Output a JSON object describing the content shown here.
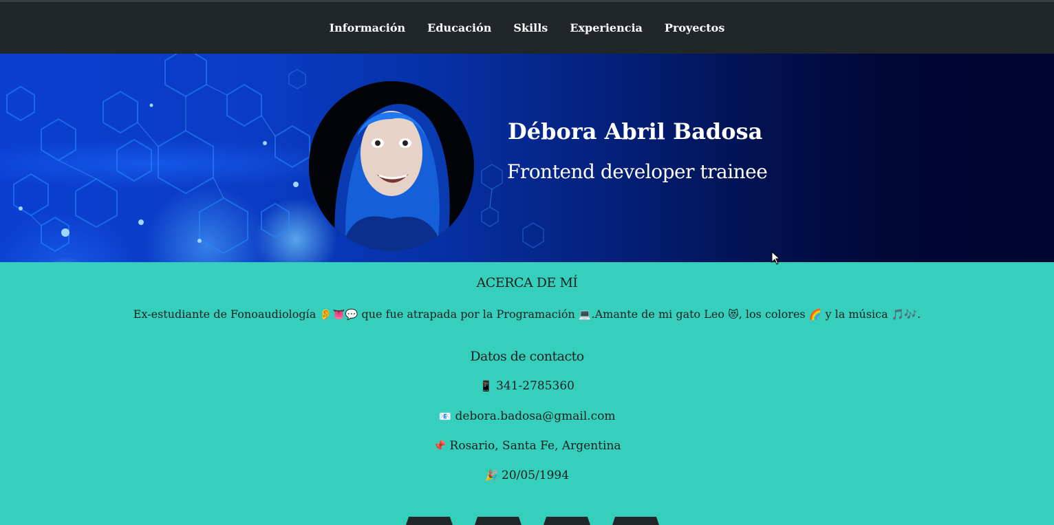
{
  "nav": {
    "items": [
      "Información",
      "Educación",
      "Skills",
      "Experiencia",
      "Proyectos"
    ]
  },
  "hero": {
    "name": "Débora Abril Badosa",
    "role": "Frontend developer trainee"
  },
  "about": {
    "heading": "ACERCA DE MÍ",
    "bio": {
      "part1": "Ex-estudiante de Fonoaudiología ",
      "emoji1": "👂👅💬",
      "part2": " que fue atrapada por la Programación ",
      "emoji2": "💻",
      "part3": ".Amante de mi gato Leo ",
      "emoji3": "😻",
      "part4": ", los colores ",
      "emoji4": "🌈",
      "part5": " y la música ",
      "emoji5": "🎵🎶",
      "part6": "."
    },
    "contact_heading": "Datos de contacto",
    "contact": {
      "phone_icon": "📱",
      "phone": "341-2785360",
      "email_icon": "📧",
      "email": "debora.badosa@gmail.com",
      "location_icon": "📌",
      "location": "Rosario, Santa Fe, Argentina",
      "birthday_icon": "🎉",
      "birthday": "20/05/1994"
    }
  },
  "colors": {
    "navbar": "#212628",
    "about_bg": "#36cfbb",
    "text": "#1a1f21"
  }
}
